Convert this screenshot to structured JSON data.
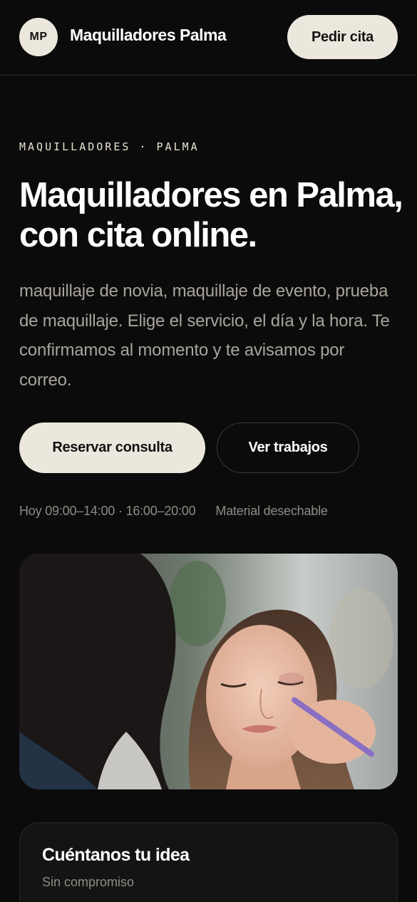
{
  "header": {
    "logo_initials": "MP",
    "brand_name": "Maquilladores Palma",
    "cta_label": "Pedir cita"
  },
  "hero": {
    "eyebrow": "MAQUILLADORES · PALMA",
    "title": "Maquilladores en Palma, con cita online.",
    "description": "maquillaje de novia, maquillaje de evento, prueba de maquillaje. Elige el servicio, el día y la hora. Te confirmamos al momento y te avisamos por correo.",
    "primary_button": "Reservar consulta",
    "secondary_button": "Ver trabajos",
    "hours": "Hoy 09:00–14:00 · 16:00–20:00",
    "material_note": "Material desechable"
  },
  "image": {
    "subject": "makeup-artist-applying-eyeshadow-photo"
  },
  "card": {
    "title": "Cuéntanos tu idea",
    "subtitle": "Sin compromiso"
  },
  "colors": {
    "background": "#0b0b0b",
    "accent": "#ece7dc",
    "muted_text": "#a8a49c"
  }
}
